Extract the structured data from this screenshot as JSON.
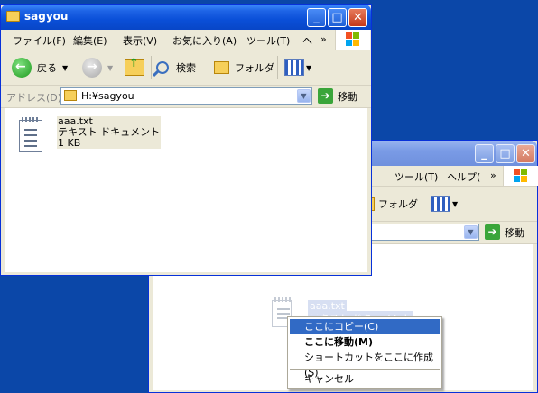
{
  "front_window": {
    "title": "sagyou",
    "menu": [
      "ファイル(F)",
      "編集(E)",
      "表示(V)",
      "お気に入り(A)",
      "ツール(T)",
      "ヘ"
    ],
    "menu_more": "»",
    "toolbar": {
      "back_label": "戻る",
      "search_label": "検索",
      "folders_label": "フォルダ"
    },
    "address": {
      "label": "アドレス(D)",
      "value": "H:¥sagyou",
      "go_label": "移動"
    },
    "file": {
      "name": "aaa.txt",
      "type": "テキスト ドキュメント",
      "size": "1 KB"
    }
  },
  "back_window": {
    "menu": [
      "ツール(T)",
      "ヘルプ(",
      "»"
    ],
    "folders_label": "フォルダ",
    "go_label": "移動",
    "ghost_file": {
      "name": "aaa.txt",
      "type": "テキスト ドキュメント"
    }
  },
  "context_menu": {
    "items": [
      {
        "label": "ここにコピー(C)",
        "selected": true,
        "bold": false
      },
      {
        "label": "ここに移動(M)",
        "selected": false,
        "bold": true
      },
      {
        "label": "ショートカットをここに作成(S)",
        "selected": false,
        "bold": false
      },
      {
        "label": "キャンセル",
        "selected": false,
        "bold": false
      }
    ]
  },
  "colors": {
    "desktop": "#0b47a8",
    "titlebar_active": "#0a4fd8",
    "selection": "#316ac5"
  },
  "icons": [
    "folder-icon",
    "back-arrow-icon",
    "forward-arrow-icon",
    "up-folder-icon",
    "search-icon",
    "folders-icon",
    "views-icon",
    "go-arrow-icon",
    "text-file-icon",
    "windows-logo-icon"
  ]
}
